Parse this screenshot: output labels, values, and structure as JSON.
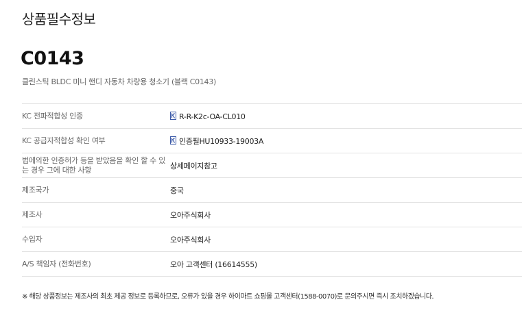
{
  "section": {
    "title": "상품필수정보"
  },
  "product": {
    "code": "C0143",
    "name": "클린스틱 BLDC 미니 핸디 자동차 차량용 청소기 (블랙 C0143)"
  },
  "rows": [
    {
      "label": "KC 전파적합성 인증",
      "value": "R-R-K2c-OA-CL010",
      "icon": "kc-certification-icon"
    },
    {
      "label": "KC 공급자적합성 확인 여부",
      "value": "인증필HU10933-19003A",
      "icon": "kc-certification-icon"
    },
    {
      "label": "법에의한 인증허가 등을 받았음을 확인 할 수 있는 경우 그에 대한 사항",
      "value": "상세페이지참고"
    },
    {
      "label": "제조국가",
      "value": "중국"
    },
    {
      "label": "제조사",
      "value": "오아주식회사"
    },
    {
      "label": "수입자",
      "value": "오아주식회사"
    },
    {
      "label": "A/S 책임자 (전화번호)",
      "value": "오아 고객센터 (16614555)"
    }
  ],
  "notice": "※ 해당 상품정보는 제조사의 최초 제공 정보로 등록하므로, 오류가 있을 경우 하이마트 쇼핑몰 고객센터(1588-0070)로 문의주시면 즉시 조치하겠습니다.",
  "colors": {
    "kc_mark": "#3b5aa8",
    "divider": "#e1e1e1"
  }
}
